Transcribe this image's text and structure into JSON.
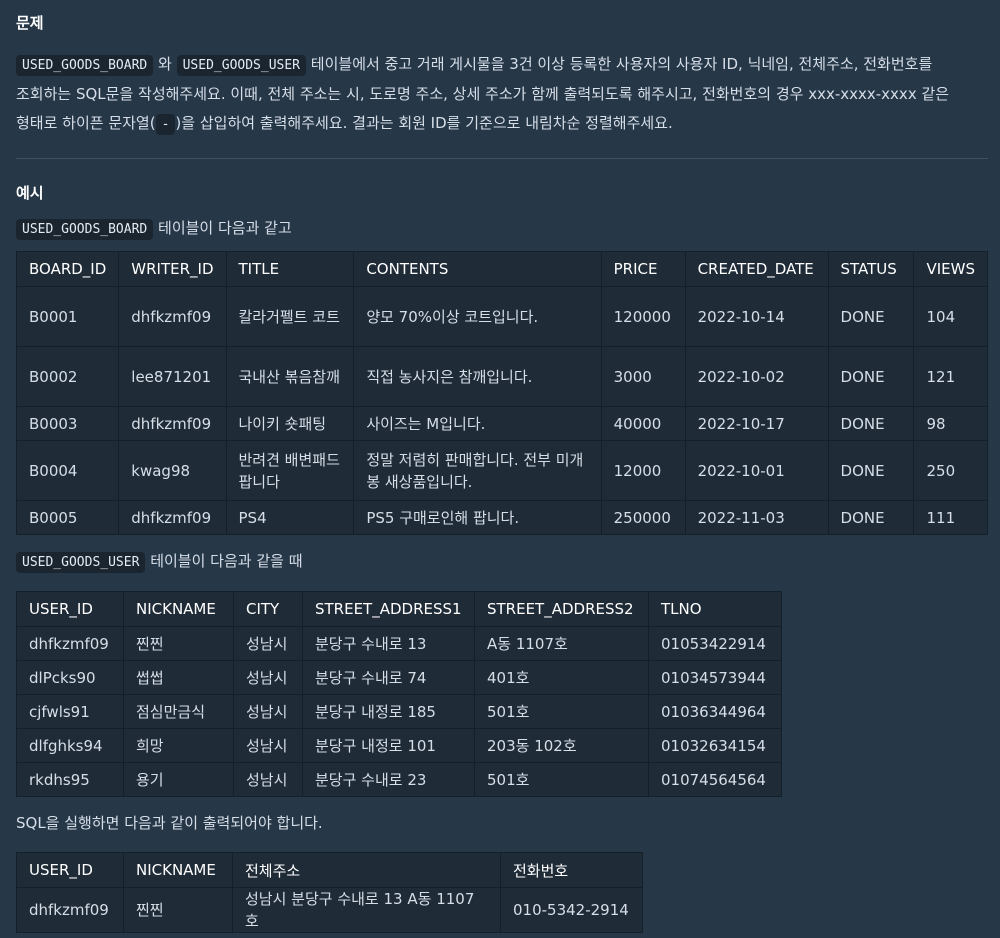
{
  "problem": {
    "heading": "문제",
    "code1": "USED_GOODS_BOARD",
    "and_word": "와",
    "code2": "USED_GOODS_USER",
    "line1_rest": "테이블에서 중고 거래 게시물을 3건 이상 등록한 사용자의 사용자 ID, 닉네임, 전체주소, 전화번호를",
    "line2": "조회하는 SQL문을 작성해주세요. 이때, 전체 주소는 시, 도로명 주소, 상세 주소가 함께 출력되도록 해주시고, 전화번호의 경우 xxx-xxxx-xxxx 같은",
    "line3_pre": "형태로 하이픈 문자열(",
    "hyphen": "-",
    "line3_post": ")을 삽입하여 출력해주세요. 결과는 회원 ID를 기준으로 내림차순 정렬해주세요."
  },
  "example": {
    "heading": "예시",
    "board_code": "USED_GOODS_BOARD",
    "board_text": "테이블이 다음과 같고",
    "user_code": "USED_GOODS_USER",
    "user_text": "테이블이 다음과 같을 때",
    "result_text": "SQL을 실행하면 다음과 같이 출력되어야 합니다."
  },
  "board_table": {
    "headers": [
      "BOARD_ID",
      "WRITER_ID",
      "TITLE",
      "CONTENTS",
      "PRICE",
      "CREATED_DATE",
      "STATUS",
      "VIEWS"
    ],
    "rows": [
      [
        "B0001",
        "dhfkzmf09",
        "칼라거펠트 코트",
        "양모 70%이상 코트입니다.",
        "120000",
        "2022-10-14",
        "DONE",
        "104"
      ],
      [
        "B0002",
        "lee871201",
        "국내산 볶음참깨",
        "직접 농사지은 참깨입니다.",
        "3000",
        "2022-10-02",
        "DONE",
        "121"
      ],
      [
        "B0003",
        "dhfkzmf09",
        "나이키 숏패팅",
        "사이즈는 M입니다.",
        "40000",
        "2022-10-17",
        "DONE",
        "98"
      ],
      [
        "B0004",
        "kwag98",
        "반려견 배변패드 팝니다",
        "정말 저렴히 판매합니다. 전부 미개봉 새상품입니다.",
        "12000",
        "2022-10-01",
        "DONE",
        "250"
      ],
      [
        "B0005",
        "dhfkzmf09",
        "PS4",
        "PS5 구매로인해 팝니다.",
        "250000",
        "2022-11-03",
        "DONE",
        "111"
      ]
    ]
  },
  "user_table": {
    "headers": [
      "USER_ID",
      "NICKNAME",
      "CITY",
      "STREET_ADDRESS1",
      "STREET_ADDRESS2",
      "TLNO"
    ],
    "rows": [
      [
        "dhfkzmf09",
        "찐찐",
        "성남시",
        "분당구 수내로 13",
        "A동 1107호",
        "01053422914"
      ],
      [
        "dlPcks90",
        "썹썹",
        "성남시",
        "분당구 수내로 74",
        "401호",
        "01034573944"
      ],
      [
        "cjfwls91",
        "점심만금식",
        "성남시",
        "분당구 내정로 185",
        "501호",
        "01036344964"
      ],
      [
        "dlfghks94",
        "희망",
        "성남시",
        "분당구 내정로 101",
        "203동 102호",
        "01032634154"
      ],
      [
        "rkdhs95",
        "용기",
        "성남시",
        "분당구 수내로 23",
        "501호",
        "01074564564"
      ]
    ]
  },
  "result_table": {
    "headers": [
      "USER_ID",
      "NICKNAME",
      "전체주소",
      "전화번호"
    ],
    "rows": [
      [
        "dhfkzmf09",
        "찐찐",
        "성남시 분당구 수내로 13 A동 1107호",
        "010-5342-2914"
      ]
    ]
  }
}
